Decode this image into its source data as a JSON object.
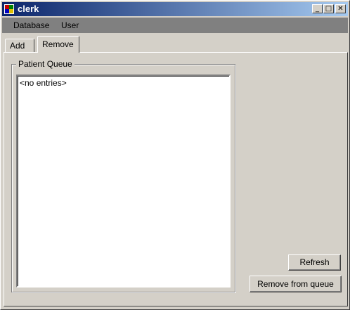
{
  "window": {
    "title": "clerk",
    "controls": {
      "minimize": "_",
      "maximize": "□",
      "close": "✕"
    }
  },
  "menubar": {
    "items": [
      {
        "label": "Database"
      },
      {
        "label": "User"
      }
    ]
  },
  "tabs": [
    {
      "label": "Add",
      "selected": false
    },
    {
      "label": "Remove",
      "selected": true
    }
  ],
  "patient_queue": {
    "title": "Patient Queue",
    "entries": [
      "<no entries>"
    ]
  },
  "buttons": {
    "refresh": "Refresh",
    "remove_from_queue": "Remove from queue"
  },
  "colors": {
    "face": "#d4d0c8",
    "titlebar_start": "#0a246a",
    "titlebar_end": "#a6caf0",
    "menubar": "#808080"
  }
}
